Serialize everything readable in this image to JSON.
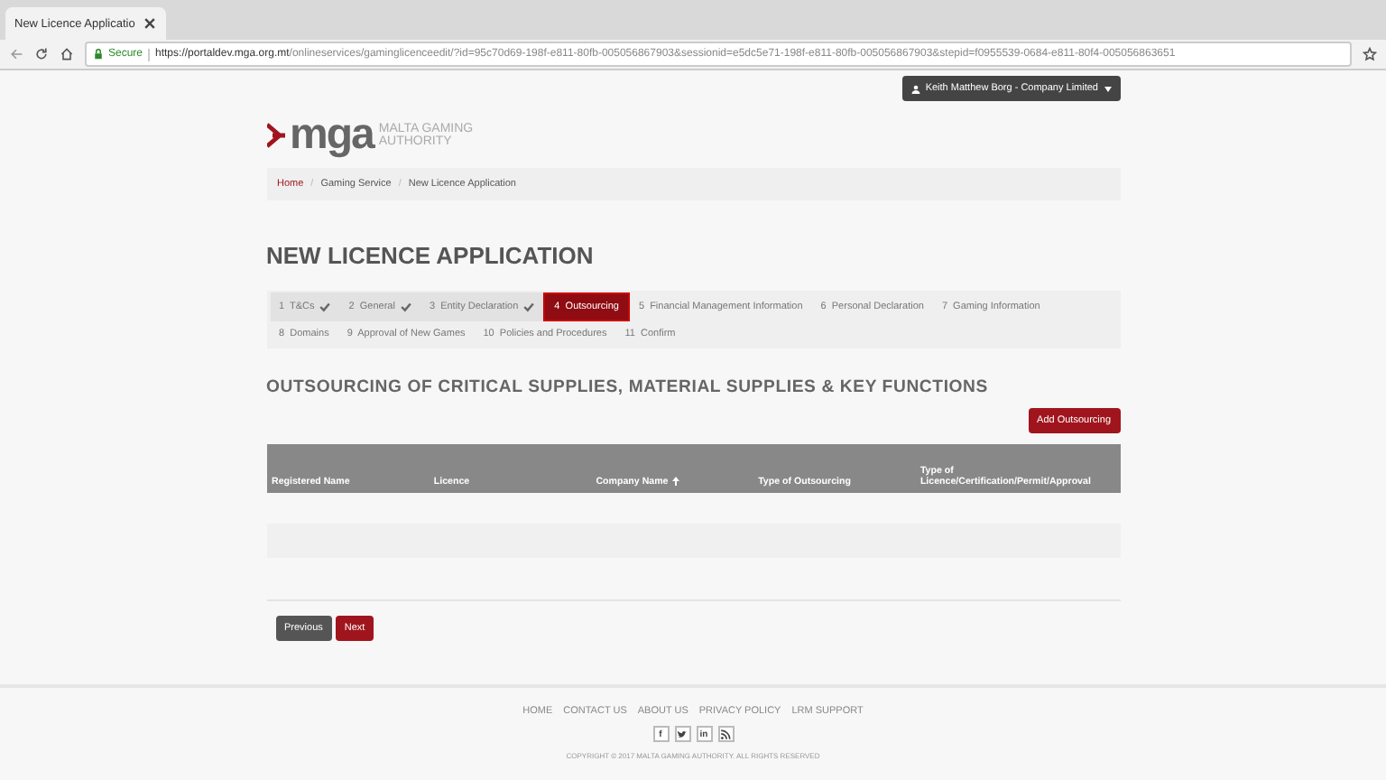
{
  "browser": {
    "tab_title": "New Licence Applicatio",
    "secure_label": "Secure",
    "url_host": "https://portaldev.mga.org.mt",
    "url_path": "/onlineservices/gaminglicenceedit/?id=95c70d69-198f-e811-80fb-005056867903&sessionid=e5dc5e71-198f-e811-80fb-005056867903&stepid=f0955539-0684-e811-80f4-005056863651"
  },
  "user_menu": {
    "label": "Keith Matthew Borg - Company Limited"
  },
  "logo": {
    "mark": "mga",
    "line1": "MALTA GAMING",
    "line2": "AUTHORITY"
  },
  "breadcrumb_separator": "/",
  "breadcrumb": [
    {
      "label": "Home",
      "link": true
    },
    {
      "label": "Gaming Service",
      "link": false
    },
    {
      "label": "New Licence Application",
      "link": false
    }
  ],
  "page_title": "NEW LICENCE APPLICATION",
  "steps": [
    {
      "label": "1  T&Cs",
      "done": true,
      "selected": false
    },
    {
      "label": "2  General",
      "done": true,
      "selected": false
    },
    {
      "label": "3  Entity Declaration",
      "done": true,
      "selected": false
    },
    {
      "label": "4  Outsourcing",
      "done": false,
      "selected": true
    },
    {
      "label": "5  Financial Management Information",
      "done": false,
      "selected": false
    },
    {
      "label": "6  Personal Declaration",
      "done": false,
      "selected": false
    },
    {
      "label": "7  Gaming Information",
      "done": false,
      "selected": false
    },
    {
      "label": "8  Domains",
      "done": false,
      "selected": false
    },
    {
      "label": "9  Approval of New Games",
      "done": false,
      "selected": false
    },
    {
      "label": "10  Policies and Procedures",
      "done": false,
      "selected": false
    },
    {
      "label": "11  Confirm",
      "done": false,
      "selected": false
    }
  ],
  "section_title": "OUTSOURCING OF CRITICAL SUPPLIES, MATERIAL SUPPLIES & KEY FUNCTIONS",
  "add_button": "Add Outsourcing",
  "table": {
    "columns": [
      {
        "label": "Registered Name",
        "sorted": false
      },
      {
        "label": "Licence",
        "sorted": false
      },
      {
        "label": "Company Name",
        "sorted": true
      },
      {
        "label": "Type of Outsourcing",
        "sorted": false
      },
      {
        "label": "Type of Licence/Certification/Permit/Approval",
        "sorted": false
      }
    ]
  },
  "buttons": [
    {
      "label": "Previous",
      "kind": "secondary"
    },
    {
      "label": "Next",
      "kind": "primary"
    }
  ],
  "footer": {
    "links": [
      "HOME",
      "CONTACT US",
      "ABOUT US",
      "PRIVACY POLICY",
      "LRM SUPPORT"
    ],
    "social": [
      {
        "kind": "glyph",
        "glyph": "f"
      },
      {
        "kind": "bird"
      },
      {
        "kind": "glyph",
        "glyph": "in"
      },
      {
        "kind": "rss"
      }
    ],
    "copyright": "COPYRIGHT © 2017 MALTA GAMING AUTHORITY. ALL RIGHTS RESERVED"
  }
}
